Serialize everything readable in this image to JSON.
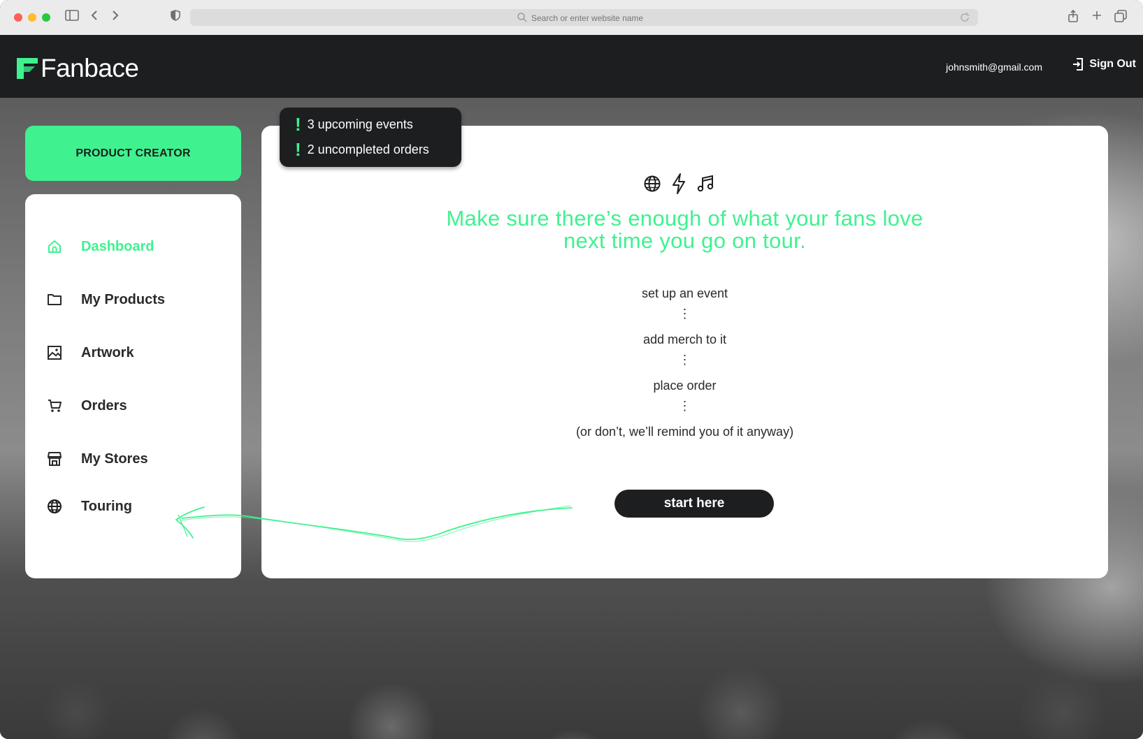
{
  "browser": {
    "url_placeholder": "Search or enter website name"
  },
  "header": {
    "logo_text": "Fanbace",
    "user_email": "johnsmith@gmail.com",
    "sign_out_label": "Sign Out"
  },
  "sidebar": {
    "creator_button": "PRODUCT CREATOR",
    "items": [
      {
        "label": "Dashboard",
        "icon": "home-icon",
        "active": true
      },
      {
        "label": "My Products",
        "icon": "folder-icon",
        "active": false
      },
      {
        "label": "Artwork",
        "icon": "image-icon",
        "active": false
      },
      {
        "label": "Orders",
        "icon": "cart-icon",
        "active": false
      },
      {
        "label": "My Stores",
        "icon": "store-icon",
        "active": false
      },
      {
        "label": "Touring",
        "icon": "globe-icon",
        "active": false
      }
    ]
  },
  "alerts": [
    {
      "text": "3 upcoming events"
    },
    {
      "text": "2 uncompleted orders"
    }
  ],
  "main": {
    "headline_line1": "Make sure there’s enough of what your fans love",
    "headline_line2": "next time you go on tour.",
    "steps": [
      "set up an event",
      "add merch to it",
      "place order",
      "(or don’t, we’ll remind you of it anyway)"
    ],
    "separator": "⋮",
    "start_button": "start here"
  },
  "colors": {
    "accent": "#3ff28f",
    "dark": "#1c1e20",
    "card": "#ffffff"
  }
}
